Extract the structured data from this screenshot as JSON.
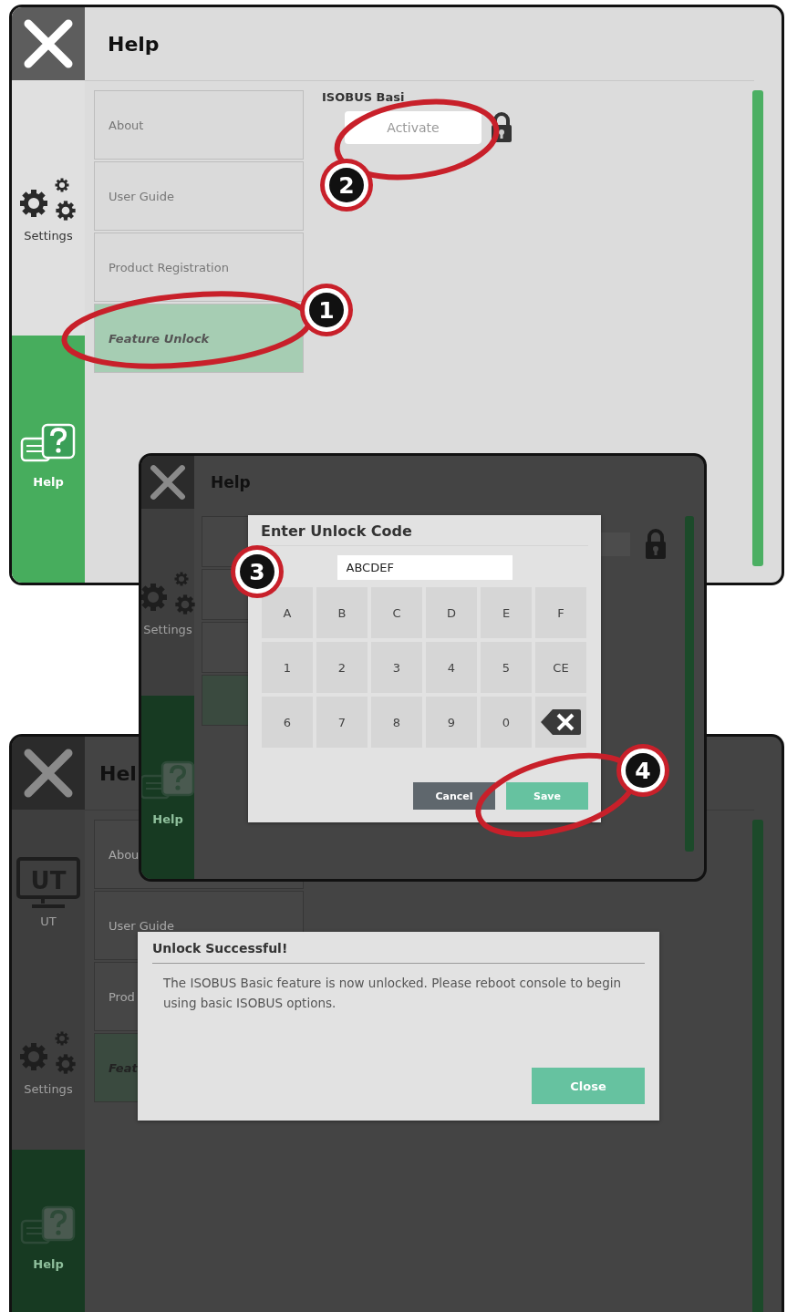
{
  "screens": [
    {
      "dimmed": false,
      "title": "Help",
      "sidebar": [
        {
          "kind": "settings",
          "label": "Settings",
          "selected": false
        },
        {
          "kind": "help",
          "label": "Help",
          "selected": true
        }
      ],
      "menu": [
        {
          "label": "About",
          "selected": false
        },
        {
          "label": "User Guide",
          "selected": false
        },
        {
          "label": "Product Registration",
          "selected": false
        },
        {
          "label": "Feature Unlock",
          "selected": true
        }
      ],
      "feature": {
        "name": "ISOBUS Basi",
        "button": "Activate",
        "locked": true
      }
    },
    {
      "dimmed": true,
      "title": "Hel",
      "sidebar": [
        {
          "kind": "ut",
          "icon_text": "UT",
          "label": "UT",
          "selected": false
        },
        {
          "kind": "settings",
          "label": "Settings",
          "selected": false
        },
        {
          "kind": "help",
          "label": "Help",
          "selected": true
        }
      ],
      "menu": [
        {
          "label": "Abou",
          "selected": false
        },
        {
          "label": "User Guide",
          "selected": false
        },
        {
          "label": "Prod",
          "selected": false
        },
        {
          "label": "Feat",
          "selected": true
        }
      ],
      "dialog": {
        "kind": "message",
        "title": "Unlock Successful!",
        "text": "The ISOBUS Basic feature is now unlocked. Please reboot console to begin using basic ISOBUS options.",
        "buttons": [
          {
            "label": "Close",
            "kind": "primary"
          }
        ]
      }
    },
    {
      "dimmed": true,
      "title": "Help",
      "sidebar": [
        {
          "kind": "settings",
          "label": "Settings",
          "selected": false
        },
        {
          "kind": "help",
          "label": "Help",
          "selected": true
        }
      ],
      "menu": [
        {
          "selected": false
        },
        {
          "selected": false
        },
        {
          "selected": false
        },
        {
          "selected": true
        }
      ],
      "feature": {
        "locked": true
      },
      "dialog": {
        "kind": "keypad",
        "title": "Enter Unlock Code",
        "value": "ABCDEF",
        "keys": [
          {
            "label": "A"
          },
          {
            "label": "B"
          },
          {
            "label": "C"
          },
          {
            "label": "D"
          },
          {
            "label": "E"
          },
          {
            "label": "F"
          },
          {
            "label": "1"
          },
          {
            "label": "2"
          },
          {
            "label": "3"
          },
          {
            "label": "4"
          },
          {
            "label": "5"
          },
          {
            "label": "CE"
          },
          {
            "label": "6"
          },
          {
            "label": "7"
          },
          {
            "label": "8"
          },
          {
            "label": "9"
          },
          {
            "label": "0"
          },
          {
            "kind": "backspace"
          }
        ],
        "buttons": [
          {
            "label": "Cancel",
            "kind": "secondary"
          },
          {
            "label": "Save",
            "kind": "primary"
          }
        ]
      }
    }
  ],
  "callouts": [
    {
      "number": "1"
    },
    {
      "number": "2"
    },
    {
      "number": "3"
    },
    {
      "number": "4"
    }
  ]
}
